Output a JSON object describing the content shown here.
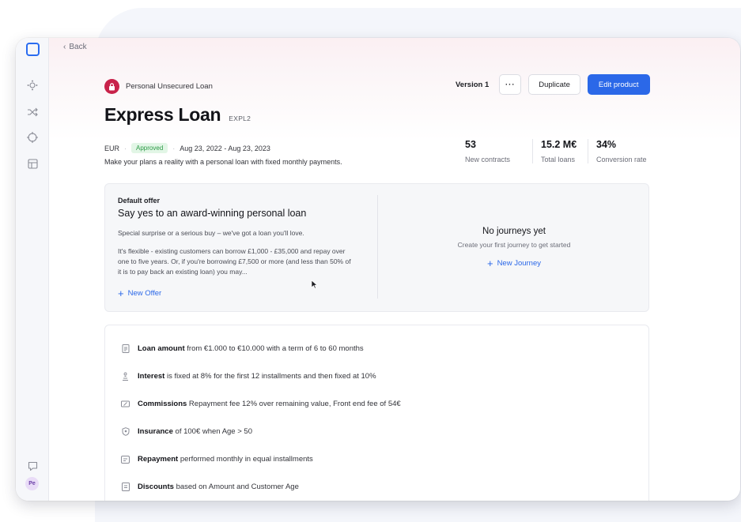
{
  "nav": {
    "back_label": "Back",
    "sidebar_avatar": "Pe"
  },
  "product": {
    "type_label": "Personal Unsecured Loan",
    "title": "Express Loan",
    "code": "EXPL2",
    "currency": "EUR",
    "status": "Approved",
    "date_range": "Aug 23, 2022 - Aug 23, 2023",
    "description": "Make your plans a reality with a personal loan with fixed monthly payments."
  },
  "actions": {
    "version": "Version 1",
    "more_label": "···",
    "duplicate_label": "Duplicate",
    "edit_label": "Edit product"
  },
  "stats": [
    {
      "value": "53",
      "label": "New contracts"
    },
    {
      "value": "15.2 M€",
      "label": "Total loans"
    },
    {
      "value": "34%",
      "label": "Conversion rate"
    }
  ],
  "offer": {
    "label": "Default offer",
    "title": "Say yes to an award-winning personal loan",
    "p1": "Special surprise or a serious buy – we've got a loan you'll love.",
    "p2": "It's flexible - existing customers can borrow £1,000 - £35,000 and repay over one to five years. Or, if you're borrowing £7,500 or more (and less than 50% of it is to pay back an existing loan) you may...",
    "new_offer_label": "New Offer"
  },
  "journeys": {
    "title": "No journeys yet",
    "subtitle": "Create your first journey to get started",
    "new_journey_label": "New Journey"
  },
  "terms": [
    {
      "bold": "Loan amount",
      "text": " from €1.000 to €10.000 with a term of 6 to 60 months"
    },
    {
      "bold": "Interest",
      "text": " is fixed at 8% for the first 12 installments and then fixed at 10%"
    },
    {
      "bold": "Commissions",
      "text": " Repayment fee 12% over remaining value, Front end fee of 54€"
    },
    {
      "bold": "Insurance",
      "text": " of 100€ when Age > 50"
    },
    {
      "bold": "Repayment",
      "text": " performed monthly in equal installments"
    },
    {
      "bold": "Discounts",
      "text": " based on Amount and Customer Age"
    }
  ]
}
